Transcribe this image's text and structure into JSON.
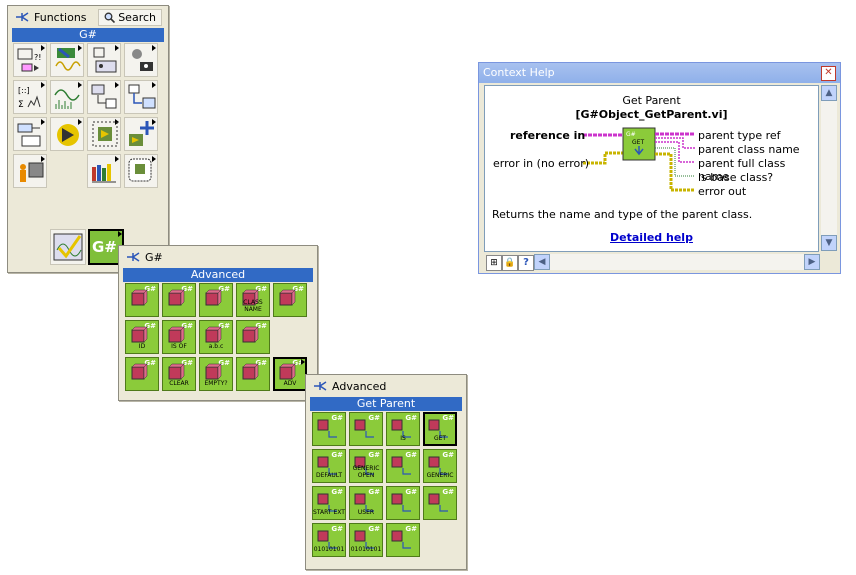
{
  "functions_palette": {
    "title": "Functions",
    "search_label": "Search",
    "category": "G#",
    "g_button_label": "G#"
  },
  "gsharp_palette": {
    "title": "G#",
    "category": "Advanced",
    "icons": [
      {
        "name": "gsharp-icon-new",
        "text": ""
      },
      {
        "name": "gsharp-icon-destroy",
        "text": ""
      },
      {
        "name": "gsharp-icon-get",
        "text": ""
      },
      {
        "name": "gsharp-icon-class-name",
        "text": "CLASS NAME"
      },
      {
        "name": "gsharp-icon-frame",
        "text": ""
      },
      {
        "name": "gsharp-icon-id",
        "text": "ID"
      },
      {
        "name": "gsharp-icon-is-of",
        "text": "IS OF"
      },
      {
        "name": "gsharp-icon-string",
        "text": "a.b.c"
      },
      {
        "name": "gsharp-icon-equal",
        "text": ""
      },
      {
        "name": "gsharp-icon-play",
        "text": ""
      },
      {
        "name": "gsharp-icon-clear",
        "text": "CLEAR"
      },
      {
        "name": "gsharp-icon-is-empty",
        "text": "EMPTY?"
      },
      {
        "name": "gsharp-icon-object",
        "text": ""
      },
      {
        "name": "gsharp-icon-adv",
        "text": "ADV"
      }
    ]
  },
  "advanced_palette": {
    "title": "Advanced",
    "category": "Get Parent",
    "icons": [
      {
        "name": "adv-icon-cast-down",
        "text": ""
      },
      {
        "name": "adv-icon-cast-up",
        "text": ""
      },
      {
        "name": "adv-icon-is-question",
        "text": "IS"
      },
      {
        "name": "adv-icon-get-parent",
        "text": "GET"
      },
      {
        "name": "adv-icon-default",
        "text": "DEFAULT"
      },
      {
        "name": "adv-icon-generic-open",
        "text": "GENERIC OPEN"
      },
      {
        "name": "adv-icon-select",
        "text": ""
      },
      {
        "name": "adv-icon-generic",
        "text": "GENERIC"
      },
      {
        "name": "adv-icon-start-ext",
        "text": "START EXT"
      },
      {
        "name": "adv-icon-user",
        "text": "USER"
      },
      {
        "name": "adv-icon-info",
        "text": ""
      },
      {
        "name": "adv-icon-gsharp-box",
        "text": ""
      },
      {
        "name": "adv-icon-binary-down",
        "text": "01010101"
      },
      {
        "name": "adv-icon-binary-up",
        "text": "01010101"
      },
      {
        "name": "adv-icon-delete",
        "text": ""
      }
    ]
  },
  "context_help": {
    "title": "Context Help",
    "vi_name": "Get Parent",
    "vi_path": "[G#Object_GetParent.vi]",
    "inputs": [
      "reference in",
      "error in (no error)"
    ],
    "outputs": [
      "parent type ref",
      "parent class name",
      "parent full class name",
      "is base class?",
      "error out"
    ],
    "node_label": "GET",
    "description": "Returns the name and type of the parent class.",
    "link": "Detailed help"
  },
  "colors": {
    "palette_bg": "#ece9d8",
    "category_bar": "#316ac5",
    "green_icon": "#8bcb3a",
    "link": "#0000cc",
    "wire_ref": "#cc33cc",
    "wire_error": "#c8b400"
  }
}
